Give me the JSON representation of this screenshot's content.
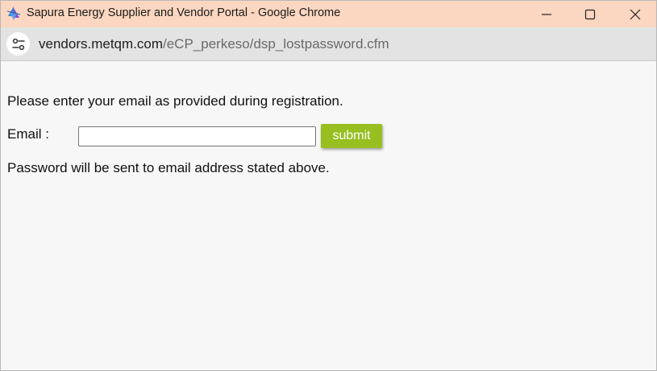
{
  "window": {
    "title": "Sapura Energy Supplier and Vendor Portal - Google Chrome",
    "icons": {
      "app": "portal-logo-icon",
      "minimize": "minimize-icon",
      "maximize": "maximize-icon",
      "close": "close-icon"
    },
    "titlebar_color": "#fbd6c0"
  },
  "addressbar": {
    "site_info_icon": "tune-icon",
    "url_host": "vendors.metqm.com",
    "url_path": "/eCP_perkeso/dsp_lostpassword.cfm"
  },
  "form": {
    "instruction": "Please enter your email as provided during registration.",
    "email_label": "Email :",
    "email_value": "",
    "email_placeholder": "",
    "submit_label": "submit",
    "submit_color": "#96bf1f",
    "note": "Password will be sent to email address stated above."
  }
}
